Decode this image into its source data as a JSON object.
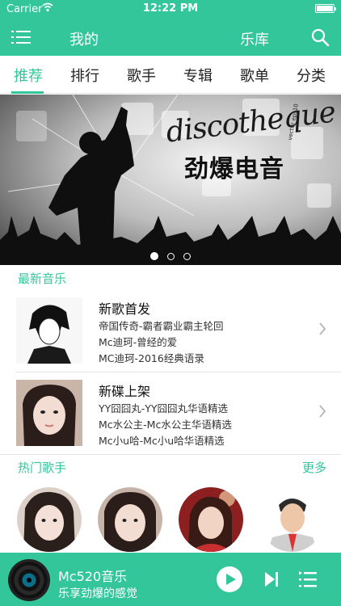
{
  "status_bar": {
    "carrier": "Carrier",
    "time": "12:22 PM"
  },
  "header": {
    "mine": "我的",
    "library": "乐库"
  },
  "categories": [
    "推荐",
    "排行",
    "歌手",
    "专辑",
    "歌单",
    "分类"
  ],
  "active_category": "推荐",
  "banner": {
    "line1": "discotheque",
    "line2": "劲爆电音",
    "small": "vector eps10",
    "slides": 3,
    "current_slide": 1
  },
  "latest": {
    "title": "最新音乐",
    "rows": [
      {
        "title": "新歌首发",
        "lines": [
          "帝国传奇-霸者霸业霸主轮回",
          "Mc迪珂-曾经的爱",
          "MC迪珂-2016经典语录"
        ]
      },
      {
        "title": "新碟上架",
        "lines": [
          "YY囧囧丸-YY囧囧丸华语精选",
          "Mc水公主-Mc水公主华语精选",
          "Mc小u哈-Mc小u哈华语精选"
        ]
      }
    ]
  },
  "hot_singers": {
    "title": "热门歌手",
    "more": "更多"
  },
  "player": {
    "name": "Mc520音乐",
    "subtitle": "乐享劲爆的感觉"
  },
  "colors": {
    "accent": "#33c69a"
  },
  "icons": [
    "wifi-icon",
    "battery-icon",
    "menu-icon",
    "search-icon",
    "chevron-right-icon",
    "play-icon",
    "next-icon",
    "playlist-icon"
  ]
}
